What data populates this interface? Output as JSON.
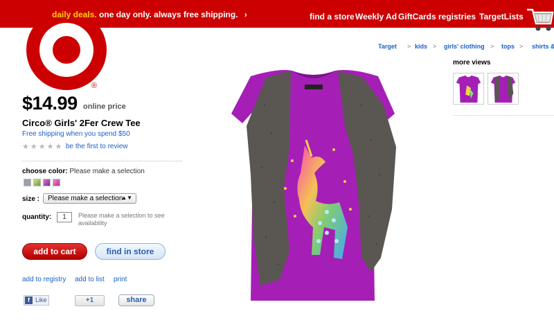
{
  "header": {
    "deals_highlight": "daily deals.",
    "deals_text": "one day only. always free shipping.",
    "deals_arrow": "›",
    "nav": [
      "find a store",
      "Weekly Ad",
      "GiftCards",
      "registries",
      "TargetLists"
    ]
  },
  "logo": {
    "mark": "®"
  },
  "breadcrumb": {
    "items": [
      "Target",
      "kids",
      "girls' clothing",
      "tops",
      "shirts &"
    ],
    "separator": ">"
  },
  "product": {
    "price": "$14.99",
    "price_note": "online price",
    "title": "Circo® Girls' 2Fer Crew Tee",
    "shipping": "Free shipping when you spend $50",
    "stars": "★★★★★",
    "review_link": "be the first to review",
    "color_label": "choose color:",
    "color_prompt": "Please make a selection",
    "swatches": [
      "#9aa0a8",
      "#a7c45a",
      "#c64fa7",
      "#d84fb0"
    ],
    "size_label": "size :",
    "size_value": "Please make a selection",
    "size_arrow": "▲▼",
    "qty_label": "quantity:",
    "qty_value": "1",
    "qty_note": "Please make a selection to see availability"
  },
  "actions": {
    "add_to_cart": "add to cart",
    "find_in_store": "find in store",
    "links": [
      "add to registry",
      "add to list",
      "print"
    ]
  },
  "social": {
    "fb_icon": "f",
    "fb_like": "Like",
    "gplus": "+1",
    "share": "share"
  },
  "more_views": {
    "title": "more views"
  },
  "colors": {
    "brand_red": "#cc0000",
    "link_blue": "#1a5fc8",
    "shirt_purple": "#a51fb6",
    "vest_gray": "#58544f"
  }
}
